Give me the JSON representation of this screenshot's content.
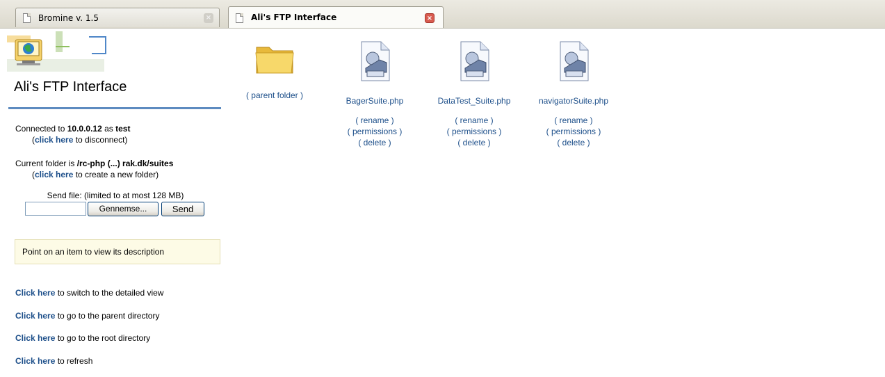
{
  "tabs": [
    {
      "label": "Bromine v. 1.5",
      "close": "×"
    },
    {
      "label": "Ali's FTP Interface",
      "close": "×"
    }
  ],
  "sidebar": {
    "title": "Ali's FTP Interface",
    "connection": {
      "prefix": "Connected to ",
      "host": "10.0.0.12",
      "mid": " as ",
      "user": "test",
      "paren_open": "(",
      "disconnect_link": "click here",
      "disconnect_suffix": " to disconnect)"
    },
    "folder": {
      "prefix": "Current folder is ",
      "path": "/rc-php (...) rak.dk/suites",
      "paren_open": "(",
      "newfolder_link": "click here",
      "newfolder_suffix": " to create a new folder)"
    },
    "send": {
      "label": "Send file: (limited to at most 128 MB)",
      "browse_label": "Gennemse...",
      "send_label": "Send"
    },
    "description": "Point on an item to view its description",
    "links": [
      {
        "link": "Click here",
        "text": " to switch to the detailed view"
      },
      {
        "link": "Click here",
        "text": " to go to the parent directory"
      },
      {
        "link": "Click here",
        "text": " to go to the root directory"
      },
      {
        "link": "Click here",
        "text": " to refresh"
      }
    ]
  },
  "files": [
    {
      "name": "( parent folder )",
      "type": "folder",
      "actions": []
    },
    {
      "name": "BagerSuite.php",
      "type": "file",
      "actions": [
        "( rename )",
        "( permissions )",
        "( delete )"
      ]
    },
    {
      "name": "DataTest_Suite.php",
      "type": "file",
      "actions": [
        "( rename )",
        "( permissions )",
        "( delete )"
      ]
    },
    {
      "name": "navigatorSuite.php",
      "type": "file",
      "actions": [
        "( rename )",
        "( permissions )",
        "( delete )"
      ]
    }
  ],
  "colors": {
    "accent": "#5d8bc0",
    "link": "#1d4f8a",
    "close_active": "#d85b4f",
    "desc_bg": "#fdfbe6"
  }
}
